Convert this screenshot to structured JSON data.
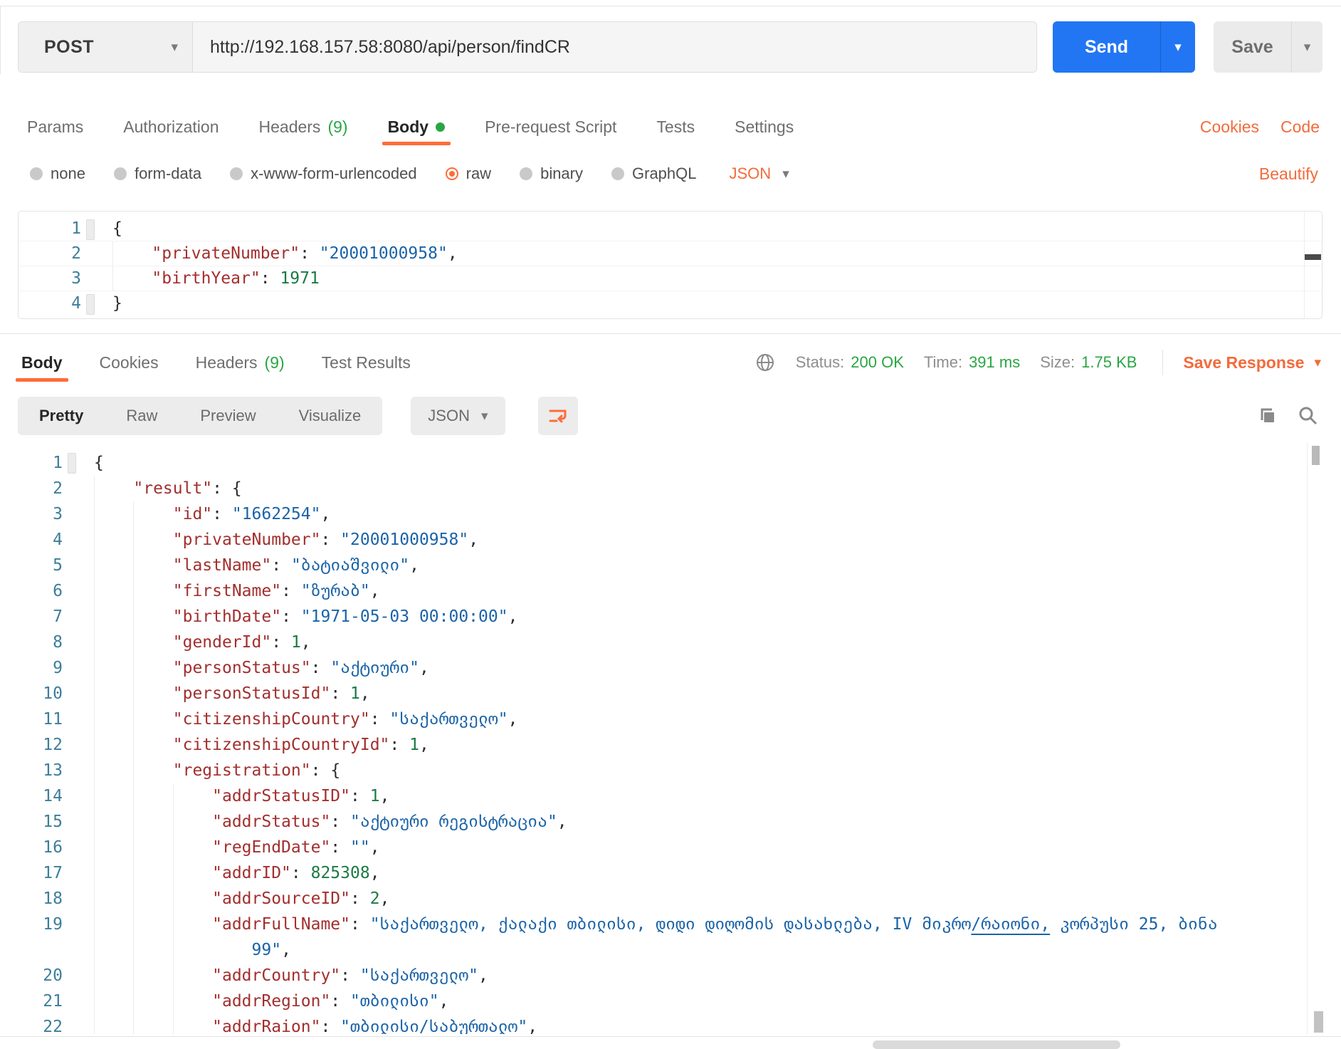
{
  "request_bar": {
    "method": "POST",
    "url": "http://192.168.157.58:8080/api/person/findCR",
    "send": "Send",
    "save": "Save"
  },
  "request_tabs": {
    "params": "Params",
    "authorization": "Authorization",
    "headers": "Headers",
    "headers_badge": "(9)",
    "body": "Body",
    "prerequest": "Pre-request Script",
    "tests": "Tests",
    "settings": "Settings",
    "cookies": "Cookies",
    "code": "Code",
    "active": "Body"
  },
  "body_type": {
    "none": "none",
    "form_data": "form-data",
    "urlencoded": "x-www-form-urlencoded",
    "raw": "raw",
    "binary": "binary",
    "graphql": "GraphQL",
    "language": "JSON",
    "beautify": "Beautify",
    "selected": "raw"
  },
  "request_editor": {
    "lines": [
      {
        "n": "1",
        "indent": 0,
        "fold": true,
        "segs": [
          [
            "p",
            "{"
          ]
        ]
      },
      {
        "n": "2",
        "indent": 1,
        "segs": [
          [
            "k",
            "\"privateNumber\""
          ],
          [
            "p",
            ": "
          ],
          [
            "s",
            "\"20001000958\""
          ],
          [
            "p",
            ","
          ]
        ]
      },
      {
        "n": "3",
        "indent": 1,
        "segs": [
          [
            "k",
            "\"birthYear\""
          ],
          [
            "p",
            ": "
          ],
          [
            "num",
            "1971"
          ]
        ]
      },
      {
        "n": "4",
        "indent": 0,
        "fold": true,
        "segs": [
          [
            "p",
            "}"
          ]
        ]
      }
    ]
  },
  "response": {
    "tabs": {
      "body": "Body",
      "cookies": "Cookies",
      "headers": "Headers",
      "headers_badge": "(9)",
      "test_results": "Test Results",
      "active": "Body"
    },
    "meta": {
      "status_label": "Status:",
      "status_value": "200 OK",
      "time_label": "Time:",
      "time_value": "391 ms",
      "size_label": "Size:",
      "size_value": "1.75 KB",
      "save_response": "Save Response"
    },
    "toolbar": {
      "pretty": "Pretty",
      "raw": "Raw",
      "preview": "Preview",
      "visualize": "Visualize",
      "language": "JSON",
      "active_view": "Pretty"
    },
    "editor": {
      "lines": [
        {
          "n": "1",
          "indent": 0,
          "fold": true,
          "segs": [
            [
              "p",
              "{"
            ]
          ]
        },
        {
          "n": "2",
          "indent": 1,
          "segs": [
            [
              "k",
              "\"result\""
            ],
            [
              "p",
              ": {"
            ]
          ]
        },
        {
          "n": "3",
          "indent": 2,
          "segs": [
            [
              "k",
              "\"id\""
            ],
            [
              "p",
              ": "
            ],
            [
              "s",
              "\"1662254\""
            ],
            [
              "p",
              ","
            ]
          ]
        },
        {
          "n": "4",
          "indent": 2,
          "segs": [
            [
              "k",
              "\"privateNumber\""
            ],
            [
              "p",
              ": "
            ],
            [
              "s",
              "\"20001000958\""
            ],
            [
              "p",
              ","
            ]
          ]
        },
        {
          "n": "5",
          "indent": 2,
          "segs": [
            [
              "k",
              "\"lastName\""
            ],
            [
              "p",
              ": "
            ],
            [
              "s",
              "\"ბატიაშვილი\""
            ],
            [
              "p",
              ","
            ]
          ]
        },
        {
          "n": "6",
          "indent": 2,
          "segs": [
            [
              "k",
              "\"firstName\""
            ],
            [
              "p",
              ": "
            ],
            [
              "s",
              "\"ზურაბ\""
            ],
            [
              "p",
              ","
            ]
          ]
        },
        {
          "n": "7",
          "indent": 2,
          "segs": [
            [
              "k",
              "\"birthDate\""
            ],
            [
              "p",
              ": "
            ],
            [
              "s",
              "\"1971-05-03 00:00:00\""
            ],
            [
              "p",
              ","
            ]
          ]
        },
        {
          "n": "8",
          "indent": 2,
          "segs": [
            [
              "k",
              "\"genderId\""
            ],
            [
              "p",
              ": "
            ],
            [
              "num",
              "1"
            ],
            [
              "p",
              ","
            ]
          ]
        },
        {
          "n": "9",
          "indent": 2,
          "segs": [
            [
              "k",
              "\"personStatus\""
            ],
            [
              "p",
              ": "
            ],
            [
              "s",
              "\"აქტიური\""
            ],
            [
              "p",
              ","
            ]
          ]
        },
        {
          "n": "10",
          "indent": 2,
          "segs": [
            [
              "k",
              "\"personStatusId\""
            ],
            [
              "p",
              ": "
            ],
            [
              "num",
              "1"
            ],
            [
              "p",
              ","
            ]
          ]
        },
        {
          "n": "11",
          "indent": 2,
          "segs": [
            [
              "k",
              "\"citizenshipCountry\""
            ],
            [
              "p",
              ": "
            ],
            [
              "s",
              "\"საქართველო\""
            ],
            [
              "p",
              ","
            ]
          ]
        },
        {
          "n": "12",
          "indent": 2,
          "segs": [
            [
              "k",
              "\"citizenshipCountryId\""
            ],
            [
              "p",
              ": "
            ],
            [
              "num",
              "1"
            ],
            [
              "p",
              ","
            ]
          ]
        },
        {
          "n": "13",
          "indent": 2,
          "segs": [
            [
              "k",
              "\"registration\""
            ],
            [
              "p",
              ": {"
            ]
          ]
        },
        {
          "n": "14",
          "indent": 3,
          "segs": [
            [
              "k",
              "\"addrStatusID\""
            ],
            [
              "p",
              ": "
            ],
            [
              "num",
              "1"
            ],
            [
              "p",
              ","
            ]
          ]
        },
        {
          "n": "15",
          "indent": 3,
          "segs": [
            [
              "k",
              "\"addrStatus\""
            ],
            [
              "p",
              ": "
            ],
            [
              "s",
              "\"აქტიური რეგისტრაცია\""
            ],
            [
              "p",
              ","
            ]
          ]
        },
        {
          "n": "16",
          "indent": 3,
          "segs": [
            [
              "k",
              "\"regEndDate\""
            ],
            [
              "p",
              ": "
            ],
            [
              "s",
              "\"\""
            ],
            [
              "p",
              ","
            ]
          ]
        },
        {
          "n": "17",
          "indent": 3,
          "segs": [
            [
              "k",
              "\"addrID\""
            ],
            [
              "p",
              ": "
            ],
            [
              "num",
              "825308"
            ],
            [
              "p",
              ","
            ]
          ]
        },
        {
          "n": "18",
          "indent": 3,
          "segs": [
            [
              "k",
              "\"addrSourceID\""
            ],
            [
              "p",
              ": "
            ],
            [
              "num",
              "2"
            ],
            [
              "p",
              ","
            ]
          ]
        },
        {
          "n": "19",
          "indent": 3,
          "segs": [
            [
              "k",
              "\"addrFullName\""
            ],
            [
              "p",
              ": "
            ],
            [
              "s",
              "\"საქართველო, ქალაქი თბილისი, დიდი დიღომის დასახლება, IV მიკრო"
            ],
            [
              "su",
              "/რაიონი,"
            ],
            [
              "s",
              " კორპუსი 25, ბინა"
            ]
          ]
        },
        {
          "n": "",
          "indent": 3,
          "segs": [
            [
              "s",
              "    99\""
            ],
            [
              "p",
              ","
            ]
          ]
        },
        {
          "n": "20",
          "indent": 3,
          "segs": [
            [
              "k",
              "\"addrCountry\""
            ],
            [
              "p",
              ": "
            ],
            [
              "s",
              "\"საქართველო\""
            ],
            [
              "p",
              ","
            ]
          ]
        },
        {
          "n": "21",
          "indent": 3,
          "segs": [
            [
              "k",
              "\"addrRegion\""
            ],
            [
              "p",
              ": "
            ],
            [
              "s",
              "\"თბილისი\""
            ],
            [
              "p",
              ","
            ]
          ]
        },
        {
          "n": "22",
          "indent": 3,
          "segs": [
            [
              "k",
              "\"addrRaion\""
            ],
            [
              "p",
              ": "
            ],
            [
              "s",
              "\"თბილისი/საბურთალო\""
            ],
            [
              "p",
              ","
            ]
          ]
        }
      ]
    }
  },
  "icons": [
    "method-caret-icon",
    "send-caret-icon",
    "save-caret-icon",
    "body-active-dot",
    "globe-icon",
    "save-response-caret-icon",
    "json-caret-icon",
    "wrap-text-icon",
    "copy-icon",
    "search-icon"
  ],
  "colors": {
    "accent_orange": "#FF6C37",
    "link_orange": "#F26B3B",
    "send_blue": "#2276F3",
    "success_green": "#29A643",
    "code_key": "#A22F2E",
    "code_string": "#1A63A8",
    "code_number": "#1A7A43",
    "line_number": "#3D7E9A"
  }
}
